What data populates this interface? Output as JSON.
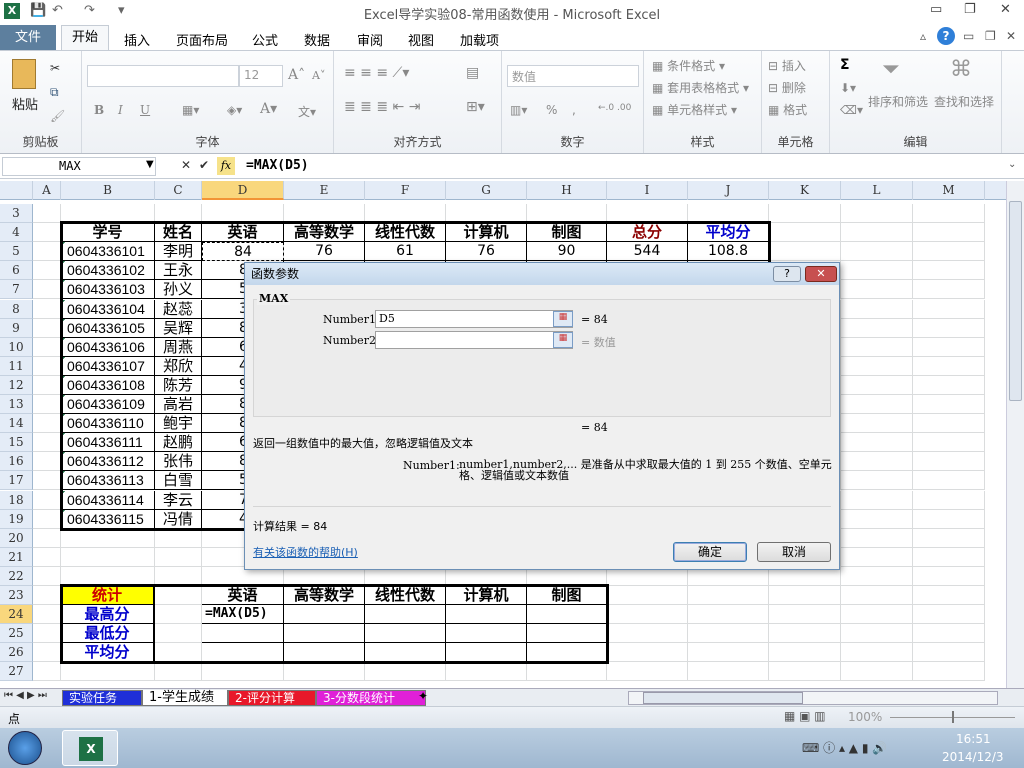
{
  "window": {
    "title": "Excel导学实验08-常用函数使用  -  Microsoft Excel"
  },
  "quick_access": {
    "save": "💾",
    "undo": "↶",
    "redo": "↷",
    "customize": "▾"
  },
  "ribbon_tabs": [
    "文件",
    "开始",
    "插入",
    "页面布局",
    "公式",
    "数据",
    "审阅",
    "视图",
    "加载项"
  ],
  "ribbon": {
    "clipboard": {
      "paste": "粘贴",
      "label": "剪贴板"
    },
    "font": {
      "name": "",
      "size": "12",
      "bold": "B",
      "italic": "I",
      "underline": "U",
      "label": "字体"
    },
    "alignment": {
      "label": "对齐方式"
    },
    "number": {
      "format": "数值",
      "percent": "%",
      "comma": ",",
      "label": "数字"
    },
    "styles": {
      "conditional": "条件格式",
      "table": "套用表格格式",
      "cell": "单元格样式",
      "label": "样式"
    },
    "cells": {
      "insert": "插入",
      "delete": "删除",
      "format": "格式",
      "label": "单元格"
    },
    "editing": {
      "sum": "Σ",
      "sort": "排序和筛选",
      "find": "查找和选择",
      "label": "编辑"
    }
  },
  "formula_bar": {
    "name_box": "MAX",
    "fx": "fx",
    "cancel": "✕",
    "enter": "✔",
    "formula": "=MAX(D5)"
  },
  "columns": [
    "A",
    "B",
    "C",
    "D",
    "E",
    "F",
    "G",
    "H",
    "I",
    "J",
    "K",
    "L",
    "M"
  ],
  "rows": [
    "3",
    "4",
    "5",
    "6",
    "7",
    "8",
    "9",
    "10",
    "11",
    "12",
    "13",
    "14",
    "15",
    "16",
    "17",
    "18",
    "19",
    "20",
    "21",
    "22",
    "23",
    "24",
    "25",
    "26",
    "27"
  ],
  "main_table": {
    "headers": [
      "学号",
      "姓名",
      "英语",
      "高等数学",
      "线性代数",
      "计算机",
      "制图",
      "总分",
      "平均分"
    ],
    "rows": [
      [
        "0604336101",
        "李明",
        "84",
        "76",
        "61",
        "76",
        "90",
        "544",
        "108.8"
      ],
      [
        "0604336102",
        "王永",
        "8"
      ],
      [
        "0604336103",
        "孙义",
        "5"
      ],
      [
        "0604336104",
        "赵蕊",
        "3"
      ],
      [
        "0604336105",
        "吴辉",
        "8"
      ],
      [
        "0604336106",
        "周燕",
        "6"
      ],
      [
        "0604336107",
        "郑欣",
        "4"
      ],
      [
        "0604336108",
        "陈芳",
        "9"
      ],
      [
        "0604336109",
        "高岩",
        "8"
      ],
      [
        "0604336110",
        "鲍宇",
        "8"
      ],
      [
        "0604336111",
        "赵鹏",
        "6"
      ],
      [
        "0604336112",
        "张伟",
        "8"
      ],
      [
        "0604336113",
        "白雪",
        "5"
      ],
      [
        "0604336114",
        "李云",
        "7"
      ],
      [
        "0604336115",
        "冯倩",
        "4"
      ]
    ]
  },
  "stats_table": {
    "title": "统计",
    "headers": [
      "英语",
      "高等数学",
      "线性代数",
      "计算机",
      "制图"
    ],
    "row_labels": [
      "最高分",
      "最低分",
      "平均分"
    ],
    "editing_cell": "=MAX(D5)"
  },
  "dialog": {
    "title": "函数参数",
    "function": "MAX",
    "args": [
      {
        "label": "Number1",
        "value": "D5",
        "result": "= 84"
      },
      {
        "label": "Number2",
        "value": "",
        "result": "= 数值"
      }
    ],
    "formula_result": "= 84",
    "description": "返回一组数值中的最大值，忽略逻辑值及文本",
    "arg_help_label": "Number1:",
    "arg_help": "number1,number2,... 是准备从中求取最大值的 1 到 255 个数值、空单元格、逻辑值或文本数值",
    "calc_result": "计算结果 =  84",
    "help_link": "有关该函数的帮助(H)",
    "ok": "确定",
    "cancel": "取消",
    "help_btn": "?",
    "close_btn": "✕"
  },
  "sheet_tabs": [
    {
      "label": "实验任务",
      "color": "#1f2fd8"
    },
    {
      "label": "1-学生成绩",
      "color": "#ffffff"
    },
    {
      "label": "2-评分计算",
      "color": "#e8182a"
    },
    {
      "label": "3-分数段统计",
      "color": "#e020d8"
    }
  ],
  "status": {
    "mode": "点",
    "zoom": "100%"
  },
  "taskbar": {
    "time": "16:51",
    "date": "2014/12/3"
  },
  "colors": {
    "total_header": "#8b0000",
    "avg_header": "#0000cc",
    "stat_bg": "#ffff00",
    "stat_title": "#cc0000",
    "stat_label": "#0000cc",
    "excel_green": "#1e7145"
  }
}
